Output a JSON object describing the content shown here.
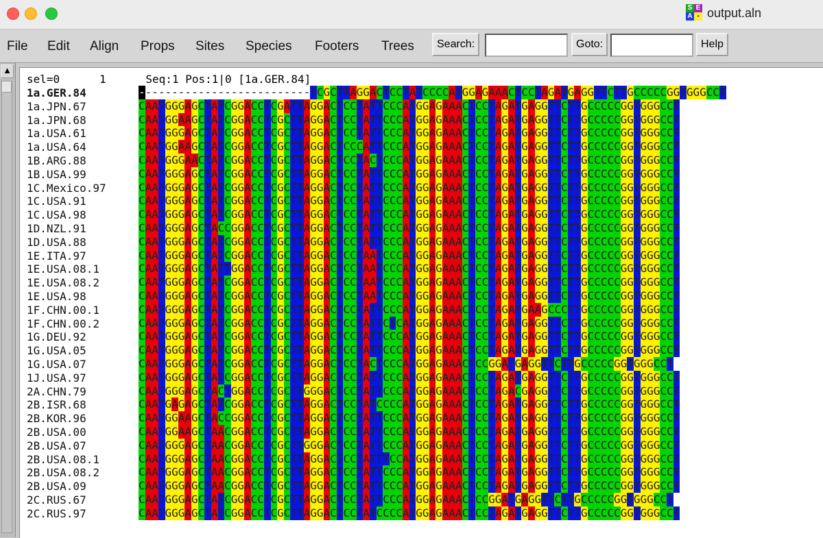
{
  "window": {
    "title": "output.aln",
    "app_icon_letters": [
      "S",
      "E",
      "A",
      "-"
    ]
  },
  "menubar": {
    "items": [
      "File",
      "Edit",
      "Align",
      "Props",
      "Sites",
      "Species",
      "Footers",
      "Trees"
    ],
    "search_label": "Search:",
    "search_value": "",
    "goto_label": "Goto:",
    "goto_value": "",
    "help_label": "Help"
  },
  "status": {
    "sel": "sel=0",
    "ruler_start": "1",
    "seq_pos": "Seq:1 Pos:1",
    "col_info": "0 [1a.GER.84]"
  },
  "colors": {
    "A": "#e8000b",
    "C": "#04d304",
    "G": "#fff200",
    "T": "#0a17d8",
    "gap": "#ffffff"
  },
  "sequences": [
    {
      "name": "1a.GER.84",
      "seq": "--------------------------TCGCTTAGGACTCCTATCCCCATGGAGAAACTCCTAGATGAGGTTCTTGCCCCCGGTGGGCCT",
      "bold": true
    },
    {
      "name": "1a.JPN.67",
      "seq": "CAATGGGAGCTATCGGACCTCGATTAGGACTCCTATTCCCATGGAGAAACTCCTAGATGAGGTTCTTGCCCCCGGTGGGCCT"
    },
    {
      "name": "1a.JPN.68",
      "seq": "CAATGGAAGCTATCGGACCTCGCTTAGGACTCCTATTCCCATGGAGAAACTCCTAGATGAGGTTCTTGCCCCCGGTGGGCCT"
    },
    {
      "name": "1a.USA.61",
      "seq": "CAATGGGAGCTATCGGACCTCGCTTAGGACTCCTATTCCCATGGAGAAACTCCTAGATGAGGTTCTTGCCCCCGGTGGGCCT"
    },
    {
      "name": "1a.USA.64",
      "seq": "CAATGGAAGCTATCGGACCTCGCTTAGGACTCCCATTCCCATGGAGAAACTCCTAGATGAGGTTCTTGCCCCCGGTGGGCCT"
    },
    {
      "name": "1B.ARG.88",
      "seq": "CAATGGGAACTATCGGACCTCGCTTAGGACTCCTACTCCCATGGAGAAACTCCTAGATGAGGTTCTTGCCCCCGGTGGGCCT"
    },
    {
      "name": "1B.USA.99",
      "seq": "CAATGGGAGCTATCGGACCTCGCTTAGGACTCCTATTCCCATGGAGAAACTCCTAGATGAGGTTCTTGCCCCCGGTGGGCCT"
    },
    {
      "name": "1C.Mexico.97",
      "seq": "CAATGGGAGCTATCGGACCTCGCTTAGGACTCCTATTCCCATGGAGAAACTCCTAGATGAGGTTCTTGCCCCCGGTGGGCCT"
    },
    {
      "name": "1C.USA.91",
      "seq": "CAATGGGAGCTATCGGACCTCGCTTAGGACTCCTATTCCCATGGAGAAACTCCTAGATGAGGTTCTTGCCCCCGGTGGGCCT"
    },
    {
      "name": "1C.USA.98",
      "seq": "CAATGGGAGCTATCGGACCTCGCTTAGGACTCCTATTCCCATGGAGAAACTCCTAGATGAGGTTCTTGCCCCCGGTGGGCCT"
    },
    {
      "name": "1D.NZL.91",
      "seq": "CAATGGGAGCTACCGGACCTCGCTTAGGACTCCTATTCCCATGGAGAAACTCCTAGATGAGGTTCTTGCCCCCGGTGGGCCT"
    },
    {
      "name": "1D.USA.88",
      "seq": "CAATGGGAGCTATCGGACCTCGCTTAGGACTCCTATTCCCATGGAGAAACTCCTAGATGAGGTTCTTGCCCCCGGTGGGCCT"
    },
    {
      "name": "1E.ITA.97",
      "seq": "CAATGGGAGCTATCGGACCTCGCTTAGGACTCCTAATCCCATGGAGAAACTCCTAGATGAGGTTCTTGCCCCCGGTGGGCCT"
    },
    {
      "name": "1E.USA.08.1",
      "seq": "CAATGGGAGCTATTGGACCTCGCTTAGGACTCCTAATCCCATGGAGAAACTCCTAGATGAGGTTCTTGCCCCCGGTGGGCCT"
    },
    {
      "name": "1E.USA.08.2",
      "seq": "CAATGGGAGCTATCGGACCTCGCTTAGGACTCCTAATCCCATGGAGAAACTCCTAGATGAGGTTCTTGCCCCCGGTGGGCCT"
    },
    {
      "name": "1E.USA.98",
      "seq": "CAATGGGAGCTATCGGACCTCGCTTAGGACTCCTAATCCCATGGAGAAACTCCTAGATGAGGTTCTTGCCCCCGGTGGGCCT"
    },
    {
      "name": "1F.CHN.00.1",
      "seq": "CAATGGGAGCTATCGGACCTCGCTTAGGACTCCTATTCCCATGGAGAAACTCCTAGATGAAGCCCTTGCCCCCGGTGGGCCT"
    },
    {
      "name": "1F.CHN.00.2",
      "seq": "CAATGGGAGCTATCGGACCTCGCTTAGGACTCCTATTCTCATGGAGAAACTCCTAGATGAGGTTCTTGCCCCCGGTGGGCCT"
    },
    {
      "name": "1G.DEU.92",
      "seq": "CAATGGGAGCTATCGGACCTCGCTTAGGACTCCTATTCCCATGGAGAAACTCCTAGATGAGGTTCTTGCCCCCGGTGGGCCT"
    },
    {
      "name": "1G.USA.05",
      "seq": "CAATGGGAGCTATCGGACCTCGCTTAGGACTCCTATTCCCATGGAGAAACTCCTAGATGAGGTTCTTGCCCCCGGTGGGCCT"
    },
    {
      "name": "1G.USA.07",
      "seq": "CAATGGGAGCTATCGGACCTCGCTTAGGACTCCTACTCCCATGGAGAAACTCCGGATGAGGTTCTTGCCCCCGGTGGGCCT"
    },
    {
      "name": "1J.USA.97",
      "seq": "CAATGGGAGCTATCGGACCTCGCTTAGGACTCCTATTCCCATGGAGAAACTCCTAGATGAGGTTCTTGCCCCCGGTGGGCCT"
    },
    {
      "name": "2A.CHN.79",
      "seq": "CAATGGGAGCTACTGGACCTCGCTTGGGACTCCTATTCCCATGGAGAAACTCCTAGACGAGGTTCTTGCCCCCGGTGGGCCT"
    },
    {
      "name": "2B.ISR.68",
      "seq": "CAATGAGAGCTATCGGACCTCGCTTAGGACTCCTATCCCCATGGAGAAACTCCTAGATGAGGTTCTTGCCCCCGGTGGGCCT"
    },
    {
      "name": "2B.KOR.96",
      "seq": "CAATGGAAGCTACCGGACCTCGCTTAGGACTCCTATTCCCATGGAGAAACTCCTAGATGAGGTTCTTGCCCCCGGTGGGCCT"
    },
    {
      "name": "2B.USA.00",
      "seq": "CAATGGAAGCTAACGGACCTCGCTTAGGACTCCTATTCCCATGGAGAAACTCCTAGATGAGGTTCTTGCCCCCGGTGGGCCT"
    },
    {
      "name": "2B.USA.07",
      "seq": "CAATGGGAGCTAACGGACCTCGCTTGGGACTCCTATTCCCATGGAGAAACTCCTAGATGAGGTTCTTGCCCCCGGTGGGCCT"
    },
    {
      "name": "2B.USA.08.1",
      "seq": "CAATGGGAGCTAACGGACCTCGCTTAGGACTCCTATTTCCATGGAGAAACTCCTAGATGAGGTTCTTGCCCCCGGTGGGCCT"
    },
    {
      "name": "2B.USA.08.2",
      "seq": "CAATGGGAGCTAACGGACCTCGCTTAGGACTCCTATTCCCATGGAGAAACTCCTAGATGAGGTTCTTGCCCCCGGTGGGCCT"
    },
    {
      "name": "2B.USA.09",
      "seq": "CAATGGGAGCTAACGGACCTCGCTTAGGACTCCTATTCCCATGGAGAAACTCCTAGATGAGGTTCTTGCCCCCGGTGGGCCT"
    },
    {
      "name": "2C.RUS.67",
      "seq": "CAATGGGAGCTATCGGACCTCGCTTAGGACTCCTATTCCCATGGAGAAACTCCGGATGAGGTTCTTGCCCCCGGTGGGCCT"
    },
    {
      "name": "2C.RUS.97",
      "seq": "CAATGGGAGCTATCGGACCTCGCTTAGGACTCCTATCCCCATGGAGAAACTCCTAGATGAGGTTCTTGCCCCCGGTGGGCCT"
    }
  ]
}
